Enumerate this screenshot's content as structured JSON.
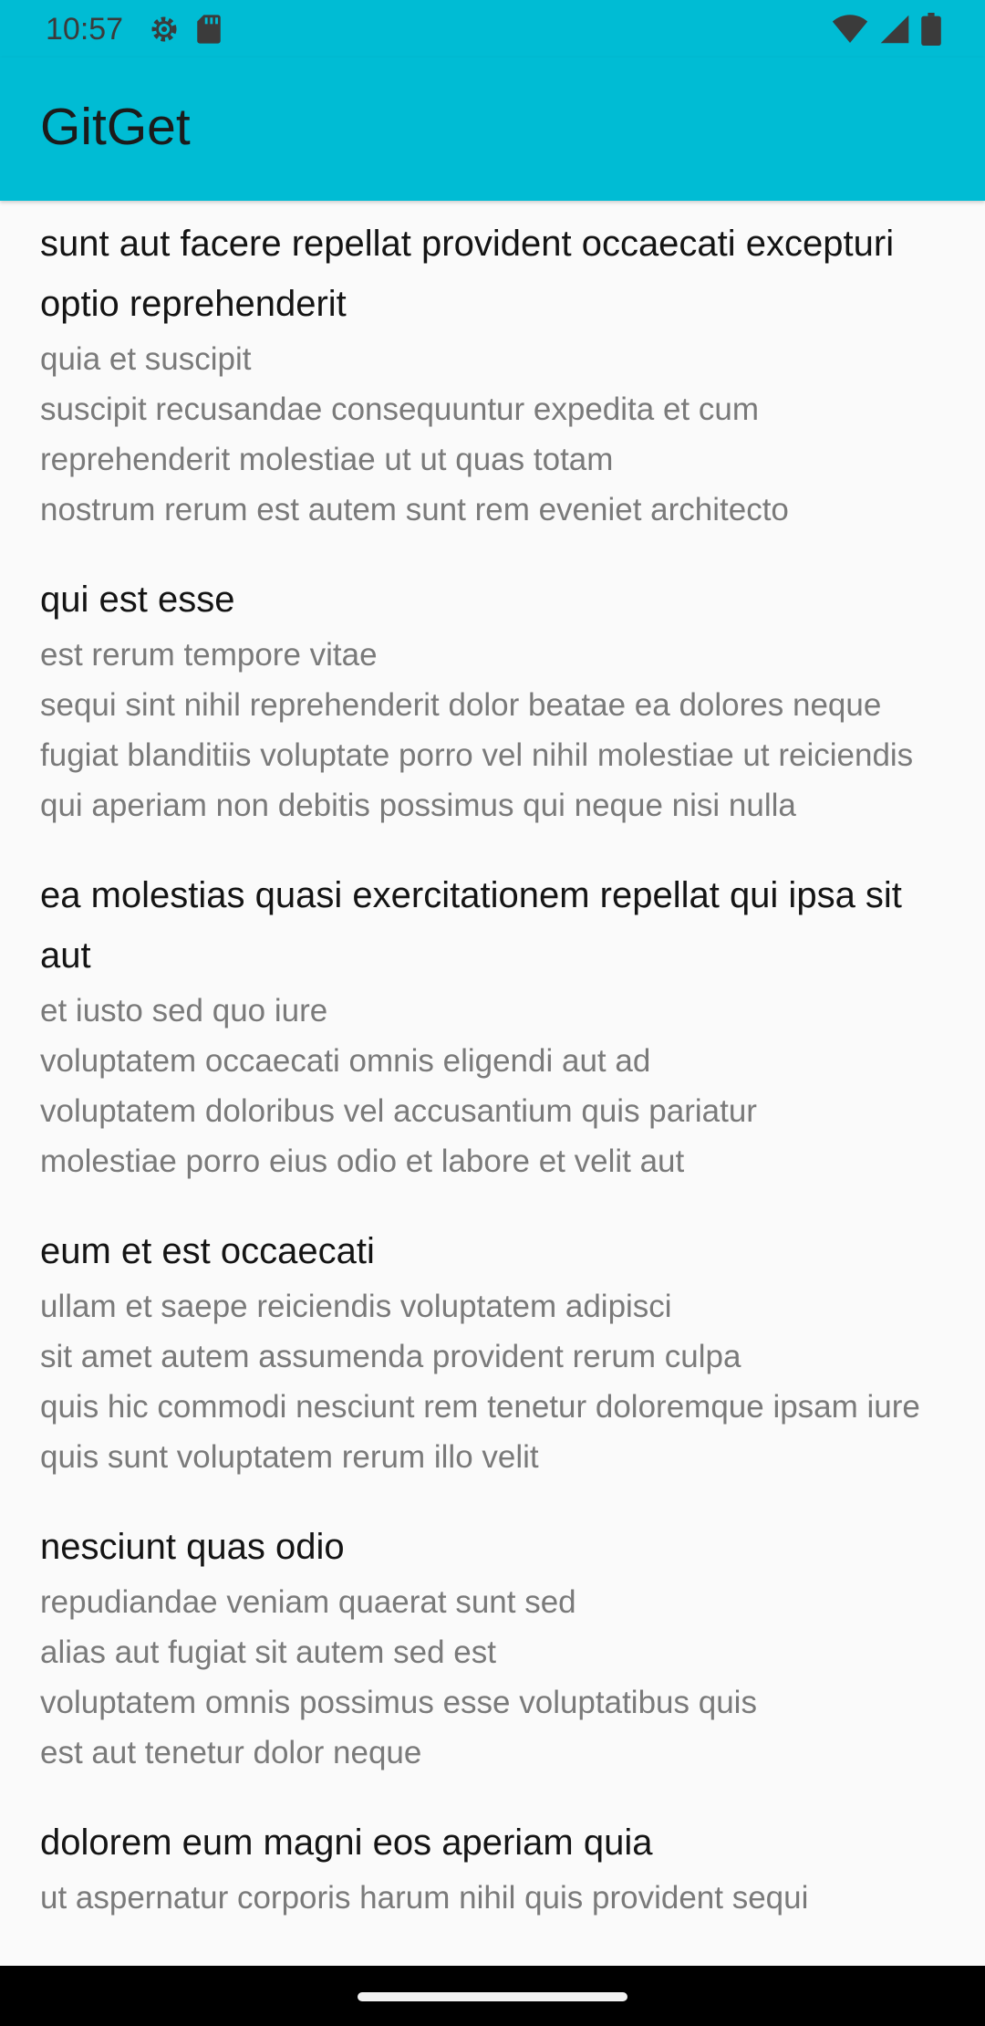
{
  "status_bar": {
    "time": "10:57",
    "left_icons": [
      "gear-icon",
      "sd-card-icon"
    ],
    "right_icons": [
      "wifi-icon",
      "signal-icon",
      "battery-icon"
    ]
  },
  "app_bar": {
    "title": "GitGet",
    "color": "#00bcd4"
  },
  "posts": [
    {
      "title": "sunt aut facere repellat provident occaecati excepturi optio reprehenderit",
      "body": "quia et suscipit\nsuscipit recusandae consequuntur expedita et cum reprehenderit molestiae ut ut quas totam\nnostrum rerum est autem sunt rem eveniet architecto"
    },
    {
      "title": "qui est esse",
      "body": "est rerum tempore vitae\nsequi sint nihil reprehenderit dolor beatae ea dolores neque\nfugiat blanditiis voluptate porro vel nihil molestiae ut reiciendis\nqui aperiam non debitis possimus qui neque nisi nulla"
    },
    {
      "title": "ea molestias quasi exercitationem repellat qui ipsa sit aut",
      "body": "et iusto sed quo iure\nvoluptatem occaecati omnis eligendi aut ad\nvoluptatem doloribus vel accusantium quis pariatur\nmolestiae porro eius odio et labore et velit aut"
    },
    {
      "title": "eum et est occaecati",
      "body": "ullam et saepe reiciendis voluptatem adipisci\nsit amet autem assumenda provident rerum culpa\nquis hic commodi nesciunt rem tenetur doloremque ipsam iure\nquis sunt voluptatem rerum illo velit"
    },
    {
      "title": "nesciunt quas odio",
      "body": "repudiandae veniam quaerat sunt sed\nalias aut fugiat sit autem sed est\nvoluptatem omnis possimus esse voluptatibus quis\nest aut tenetur dolor neque"
    },
    {
      "title": "dolorem eum magni eos aperiam quia",
      "body": "ut aspernatur corporis harum nihil quis provident sequi"
    }
  ]
}
